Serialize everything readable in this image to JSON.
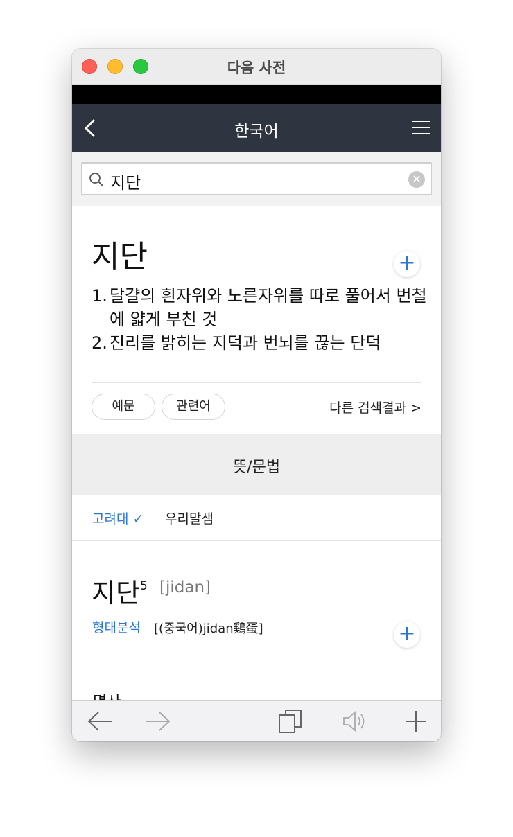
{
  "window": {
    "title": "다음 사전"
  },
  "navbar": {
    "title": "한국어",
    "icons": [
      "back-chevron-icon",
      "hamburger-menu-icon"
    ]
  },
  "search": {
    "query": "지단",
    "icons": [
      "search-icon",
      "clear-icon"
    ]
  },
  "entry": {
    "headword": "지단",
    "add_label": "+",
    "definitions": [
      {
        "num": "1.",
        "text": "달걀의 흰자위와 노른자위를 따로 풀어서 번철에 얇게 부친 것"
      },
      {
        "num": "2.",
        "text": "진리를 밝히는 지덕과 번뇌를 끊는 단덕"
      }
    ],
    "buttons": {
      "examples": "예문",
      "related": "관련어"
    },
    "more_results": "다른 검색결과 >"
  },
  "section": {
    "title": "뜻/문법"
  },
  "source_tabs": {
    "active": "고려대 ✓",
    "other": "우리말샘"
  },
  "word_detail": {
    "word": "지단",
    "superscript": "5",
    "pronunciation": "[jidan]",
    "add_label": "+",
    "morph_label": "형태분석",
    "morph_text": "[(중국어)jidan鷄蛋]",
    "part_of_speech_partial": "명사"
  },
  "toolbar": {
    "icons": [
      "back-arrow-icon",
      "forward-arrow-icon",
      "copy-icon",
      "speaker-icon",
      "add-icon"
    ]
  },
  "colors": {
    "accent": "#2b77d9",
    "navbar": "#2e3440",
    "status_bar": "#000000"
  }
}
